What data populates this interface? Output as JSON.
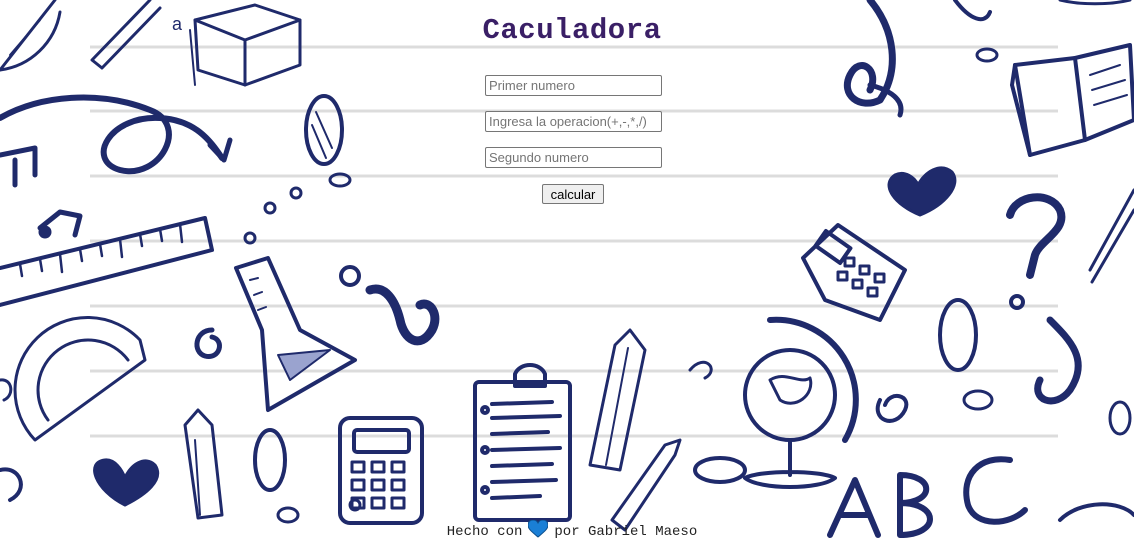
{
  "app": {
    "title": "Caculadora"
  },
  "form": {
    "first_number_placeholder": "Primer numero",
    "operation_placeholder": "Ingresa la operacion(+,-,*,/)",
    "second_number_placeholder": "Segundo numero",
    "first_number_value": "",
    "operation_value": "",
    "second_number_value": "",
    "calculate_label": "calcular"
  },
  "footer": {
    "text_before": "Hecho con",
    "text_after": "por Gabriel Maeso",
    "heart_icon": "heart-icon"
  },
  "colors": {
    "title": "#3a1f66",
    "doodle_ink": "#1f2a6b",
    "heart": "#1a7fd6",
    "background": "#ffffff"
  }
}
